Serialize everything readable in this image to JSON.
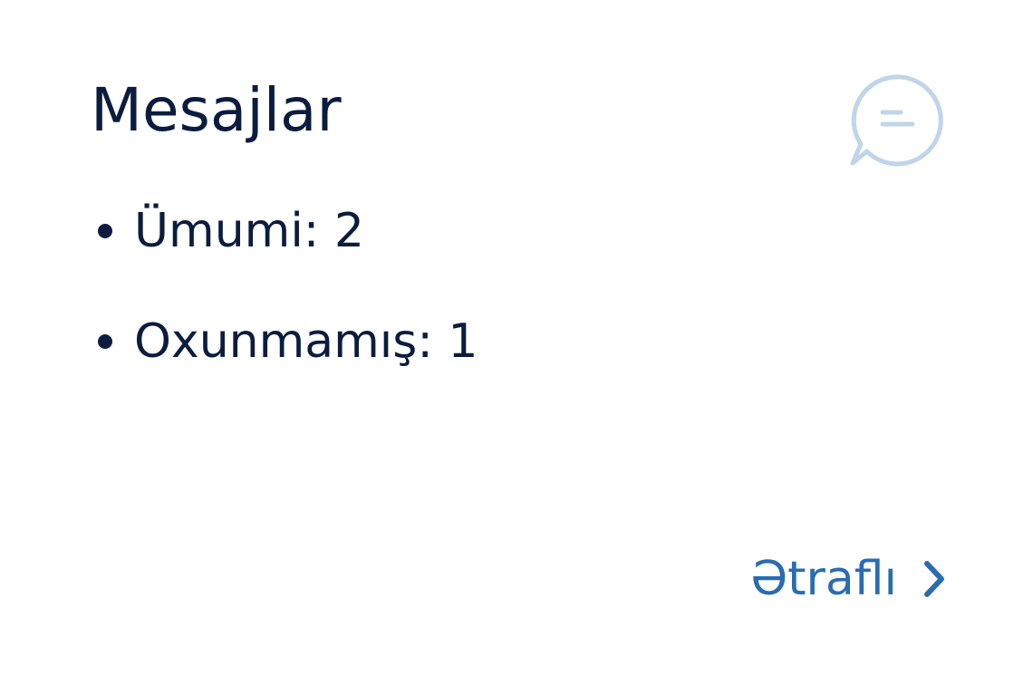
{
  "card": {
    "title": "Mesajlar",
    "icon": "chat-bubble-icon",
    "stats": [
      {
        "label": "Ümumi: 2"
      },
      {
        "label": "Oxunmamış: 1"
      }
    ],
    "more_link": {
      "label": "Ətraflı",
      "icon": "chevron-right-icon"
    }
  },
  "colors": {
    "text": "#0b1c3f",
    "accent": "#2a6cb0",
    "icon": "#c0d5ea"
  }
}
